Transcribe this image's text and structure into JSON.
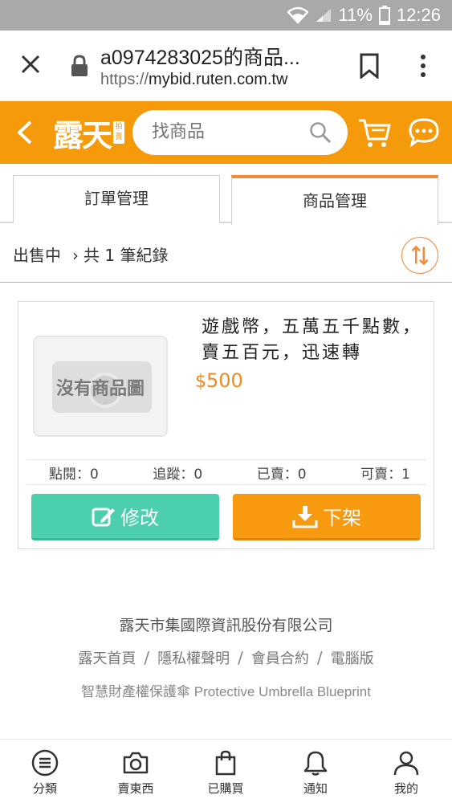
{
  "status_bar": {
    "battery": "11%",
    "time": "12:26"
  },
  "browser": {
    "title": "a0974283025的商品...",
    "url_scheme": "https://",
    "url_domain": "mybid.ruten.com.tw"
  },
  "app_header": {
    "logo_text": "露天",
    "logo_badge": "拍賣",
    "search_placeholder": "找商品"
  },
  "tabs": [
    {
      "label": "訂單管理"
    },
    {
      "label": "商品管理"
    }
  ],
  "subheader": {
    "status": "出售中",
    "record_count": "共 1 筆紀錄"
  },
  "product": {
    "thumb_text": "沒有商品圖",
    "title": "遊戲幣，五萬五千點數，賣五百元，迅速轉",
    "currency": "$",
    "price": "500",
    "stats": [
      {
        "label": "點閱：0"
      },
      {
        "label": "追蹤：0"
      },
      {
        "label": "已賣：0"
      },
      {
        "label": "可賣：1"
      }
    ],
    "edit_label": "修改",
    "unlist_label": "下架"
  },
  "footer": {
    "company": "露天市集國際資訊股份有限公司",
    "links": [
      "露天首頁",
      "隱私權聲明",
      "會員合約",
      "電腦版"
    ],
    "umbrella": "智慧財產權保護傘 Protective Umbrella Blueprint"
  },
  "bottom_nav": [
    {
      "label": "分類",
      "icon": "menu-circle-icon"
    },
    {
      "label": "賣東西",
      "icon": "camera-icon"
    },
    {
      "label": "已購買",
      "icon": "shopping-bag-icon"
    },
    {
      "label": "通知",
      "icon": "bell-icon"
    },
    {
      "label": "我的",
      "icon": "user-icon"
    }
  ],
  "colors": {
    "brand_orange": "#f59a0a",
    "edit_green": "#4bcfae",
    "price_orange": "#f08a1a"
  }
}
